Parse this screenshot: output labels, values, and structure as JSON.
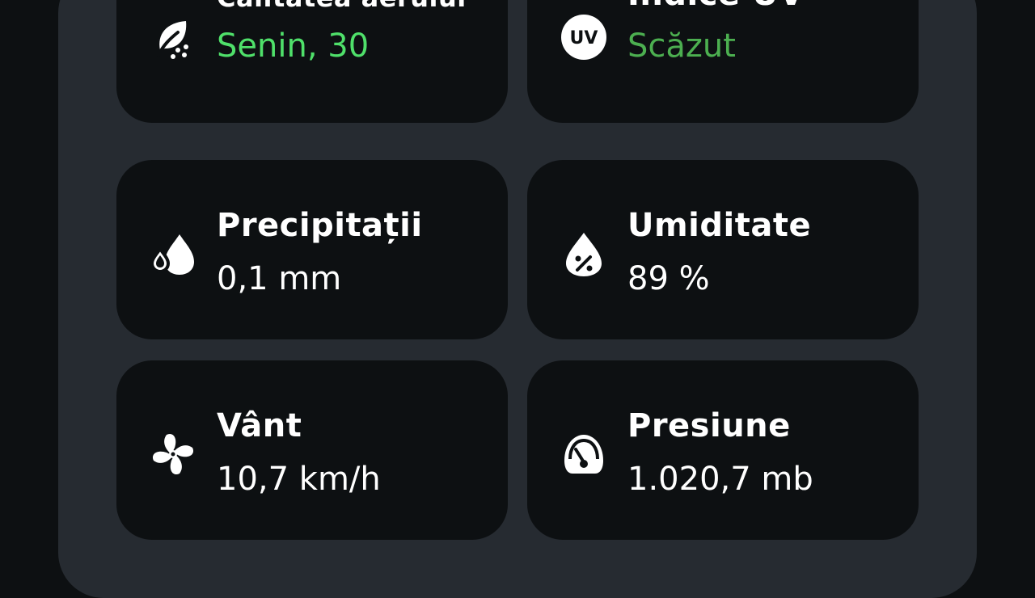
{
  "colors": {
    "background": "#0d1012",
    "panel": "#262b31",
    "tile": "#0d1012",
    "text": "#ffffff",
    "good_bright": "#4fe06a",
    "good_muted": "#4caf50"
  },
  "tiles": [
    {
      "icon": "leaf-icon",
      "title": "Calitatea aerului",
      "value": "Senin, 30"
    },
    {
      "icon": "uv-icon",
      "icon_text": "UV",
      "title": "Indice UV",
      "value": "Scăzut"
    },
    {
      "icon": "water-drop-icon",
      "title": "Precipitații",
      "value": "0,1 mm"
    },
    {
      "icon": "humidity-icon",
      "title": "Umiditate",
      "value": "89 %"
    },
    {
      "icon": "fan-icon",
      "title": "Vânt",
      "value": "10,7 km/h"
    },
    {
      "icon": "gauge-icon",
      "title": "Presiune",
      "value": "1.020,7 mb"
    }
  ]
}
